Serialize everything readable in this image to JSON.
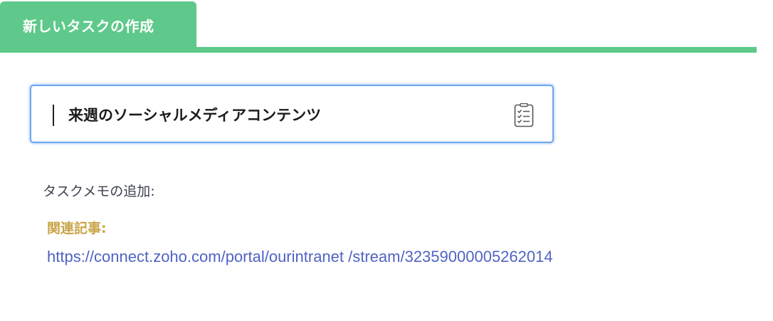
{
  "tab": {
    "label": "新しいタスクの作成"
  },
  "task_input": {
    "value": "来週のソーシャルメディアコンテンツ",
    "icon": "checklist-icon"
  },
  "memo": {
    "label": "タスクメモの追加:"
  },
  "note": {
    "related_label": "関連記事:",
    "url": "https://connect.zoho.com/portal/ourintranet /stream/32359000005262014"
  },
  "colors": {
    "accent_green": "#5ec98a",
    "focus_blue": "#6ea6f0",
    "gold": "#c9a548",
    "link_blue": "#5063c4"
  }
}
